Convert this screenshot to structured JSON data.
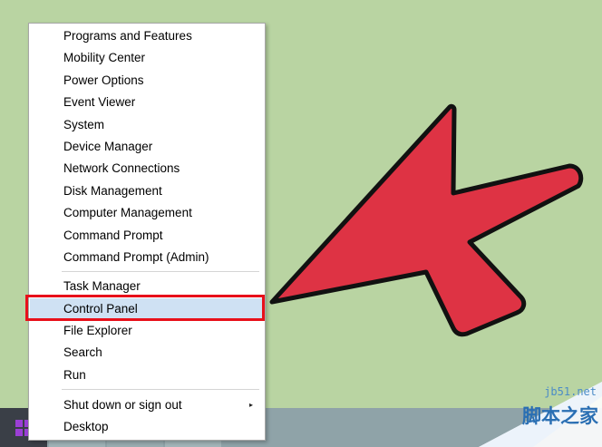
{
  "menu": {
    "items": [
      {
        "label": "Programs and Features"
      },
      {
        "label": "Mobility Center"
      },
      {
        "label": "Power Options"
      },
      {
        "label": "Event Viewer"
      },
      {
        "label": "System"
      },
      {
        "label": "Device Manager"
      },
      {
        "label": "Network Connections"
      },
      {
        "label": "Disk Management"
      },
      {
        "label": "Computer Management"
      },
      {
        "label": "Command Prompt"
      },
      {
        "label": "Command Prompt (Admin)"
      },
      {
        "label": "Task Manager"
      },
      {
        "label": "Control Panel"
      },
      {
        "label": "File Explorer"
      },
      {
        "label": "Search"
      },
      {
        "label": "Run"
      },
      {
        "label": "Shut down or sign out",
        "submenu_arrow": "▸"
      },
      {
        "label": "Desktop"
      }
    ],
    "selected_label": "Control Panel"
  },
  "colors": {
    "desktop": "#b9d4a2",
    "arrow_fill": "#de3344",
    "highlight_border": "#e8101a",
    "selected_bg": "#cfe1f3"
  },
  "watermark": {
    "site": "jb51.net",
    "brand": "脚本之家"
  },
  "icons": {
    "start": "windows-logo-icon",
    "pointer": "red-arrow-icon"
  }
}
